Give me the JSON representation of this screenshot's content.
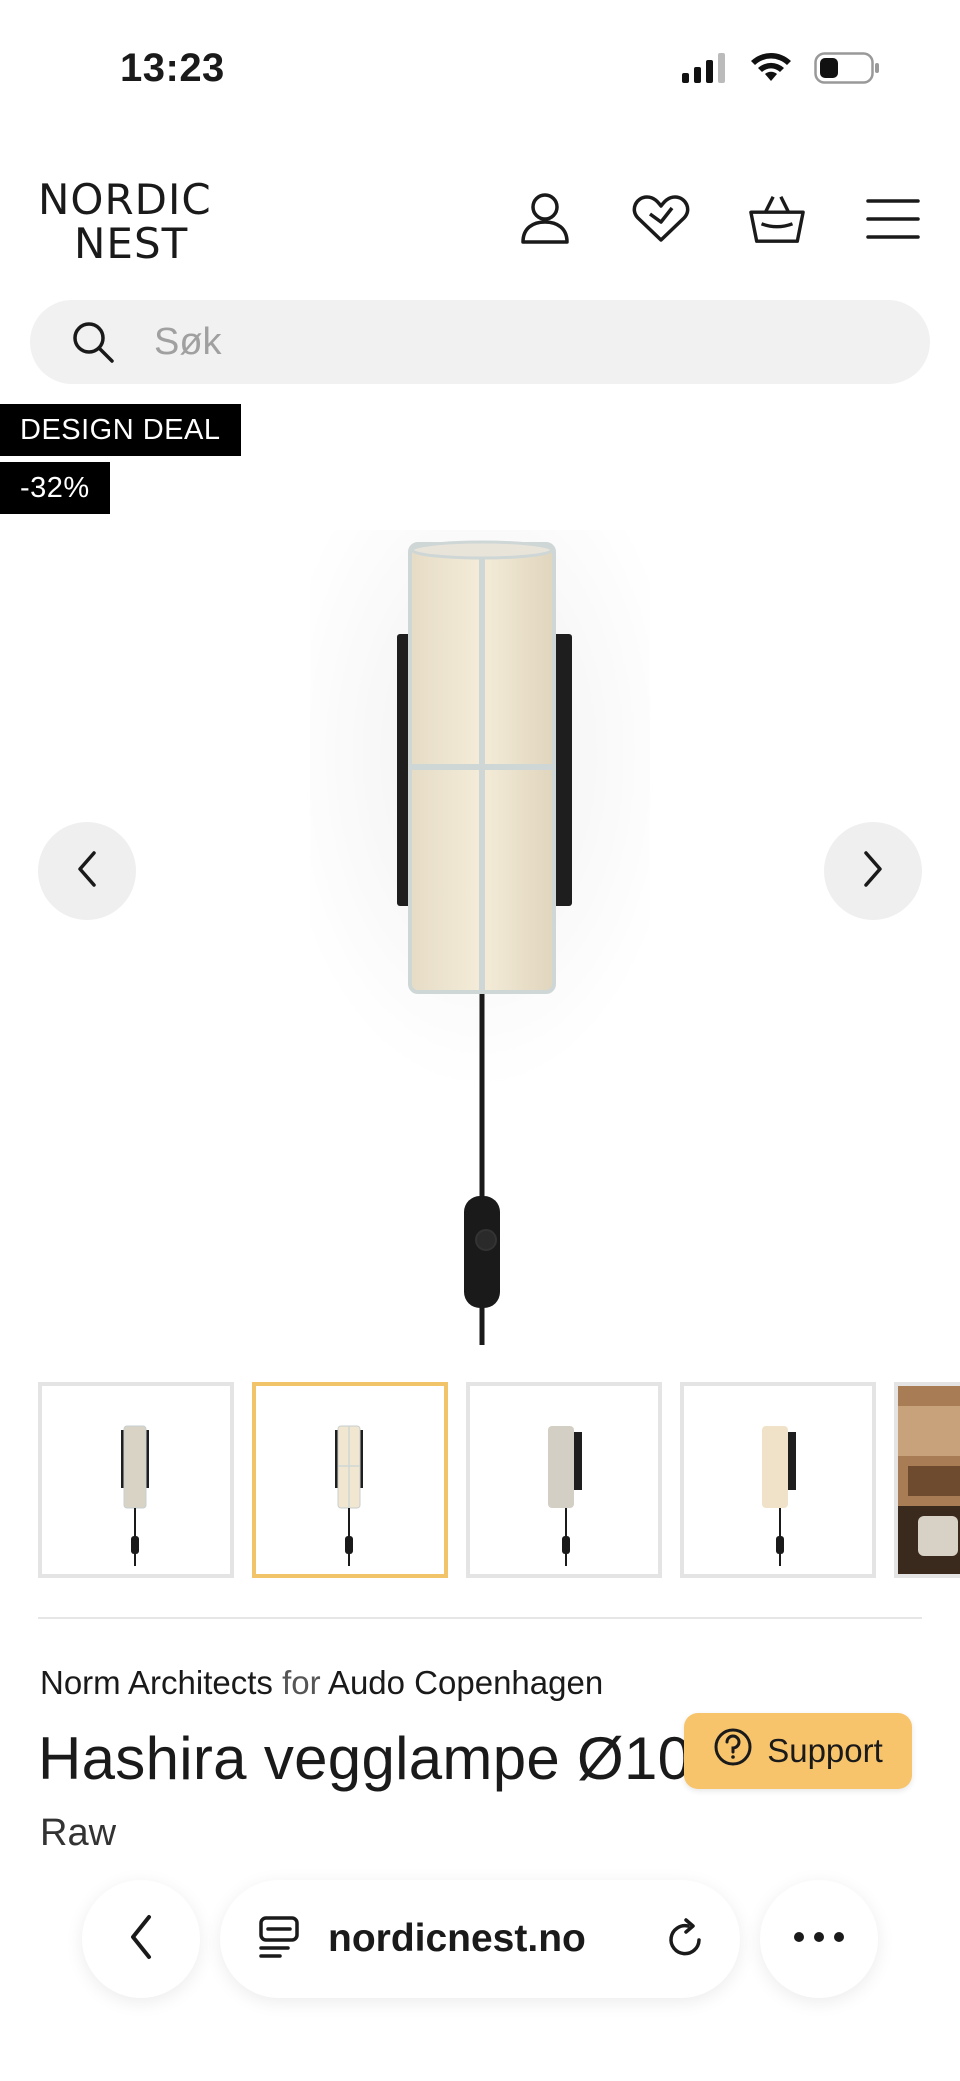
{
  "status_bar": {
    "time": "13:23",
    "icons": [
      "signal-icon",
      "wifi-icon",
      "battery-icon"
    ]
  },
  "header": {
    "logo_line1": "NORDIC",
    "logo_line2": "NEST",
    "icons": [
      "account-icon",
      "wishlist-heart-icon",
      "basket-icon",
      "menu-icon"
    ]
  },
  "search": {
    "placeholder": "Søk"
  },
  "badges": {
    "deal": "DESIGN DEAL",
    "discount": "-32%"
  },
  "gallery": {
    "selected_index": 1,
    "thumbnail_count_visible": 5
  },
  "product": {
    "designer": "Norm Architects",
    "for_text": "for",
    "brand": "Audo Copenhagen",
    "title": "Hashira vegglampe Ø10",
    "variant": "Raw"
  },
  "support": {
    "label": "Support"
  },
  "browser": {
    "url": "nordicnest.no"
  },
  "colors": {
    "accent_support": "#f7c46c",
    "thumb_selected_border": "#f2c46a",
    "badge_bg": "#000000"
  }
}
